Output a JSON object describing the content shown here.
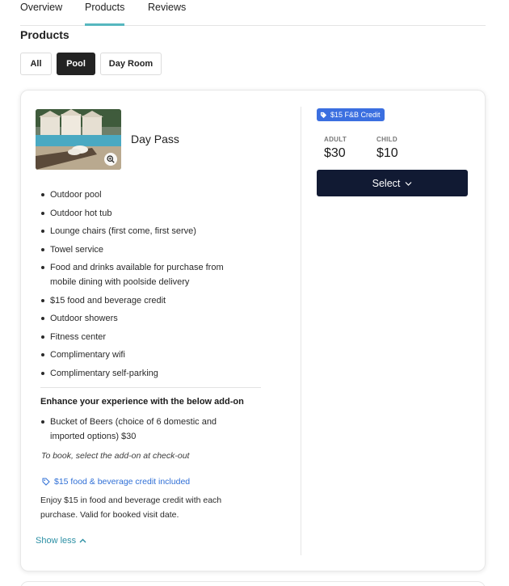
{
  "tabs": [
    {
      "label": "Overview",
      "active": false
    },
    {
      "label": "Products",
      "active": true
    },
    {
      "label": "Reviews",
      "active": false
    }
  ],
  "section_title": "Products",
  "filters": [
    {
      "label": "All",
      "active": false
    },
    {
      "label": "Pool",
      "active": true
    },
    {
      "label": "Day Room",
      "active": false
    }
  ],
  "product": {
    "name": "Day Pass",
    "image_icon": "zoom-in-icon",
    "amenities": [
      "Outdoor pool",
      "Outdoor hot tub",
      "Lounge chairs (first come, first serve)",
      "Towel service",
      "Food and drinks available for purchase from mobile dining with poolside delivery",
      "$15 food and beverage credit",
      "Outdoor showers",
      "Fitness center",
      "Complimentary wifi",
      "Complimentary self-parking"
    ],
    "addon_heading": "Enhance your experience with the below add-on",
    "addons": [
      "Bucket of Beers (choice of 6 domestic and imported options) $30"
    ],
    "book_note": "To book, select the add-on at check-out",
    "credit_link": "$15 food & beverage credit included",
    "credit_desc": "Enjoy $15 in food and beverage credit with each purchase. Valid for booked visit date.",
    "show_less": "Show less",
    "badge": "$15 F&B Credit",
    "prices": {
      "adult_label": "ADULT",
      "adult_value": "$30",
      "child_label": "CHILD",
      "child_value": "$10"
    },
    "select_label": "Select"
  },
  "colors": {
    "accent_teal": "#56b7bf",
    "link_blue": "#2f6fd6",
    "badge_blue": "#3b6fe0",
    "button_navy": "#111a33",
    "show_less_teal": "#2b8fa4"
  }
}
